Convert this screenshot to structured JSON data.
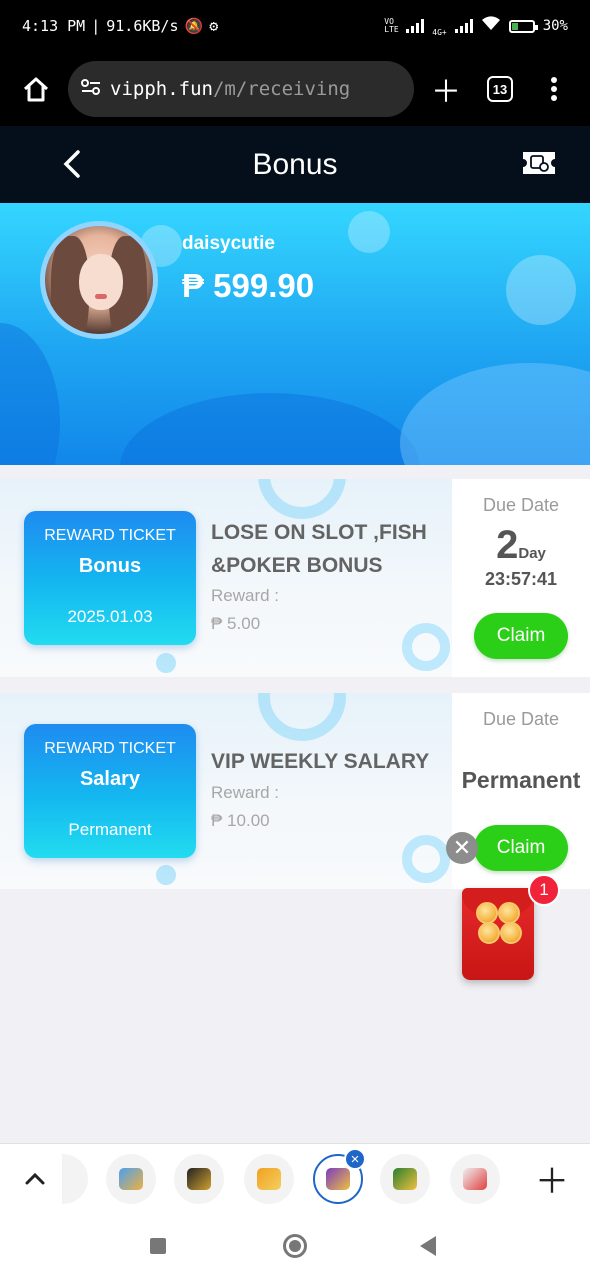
{
  "status_bar": {
    "time": "4:13 PM",
    "net_speed": "91.6KB/s",
    "battery": "30%",
    "network_label": "4G+",
    "volte_label": "VO LTE"
  },
  "browser": {
    "url_domain": "vipph.fun",
    "url_path": "/m/receiving",
    "tab_count": "13"
  },
  "header": {
    "title": "Bonus"
  },
  "profile": {
    "username": "daisycutie",
    "balance": "₱ 599.90"
  },
  "bonuses": [
    {
      "ticket_label": "REWARD TICKET",
      "ticket_name": "Bonus",
      "ticket_date": "2025.01.03",
      "title_line1": "LOSE ON SLOT ,FISH",
      "title_line2": "&POKER BONUS",
      "reward_label": "Reward :",
      "reward_value": "₱ 5.00",
      "due_label": "Due Date",
      "due_days": "2",
      "due_days_unit": "Day",
      "due_time": "23:57:41",
      "claim_label": "Claim"
    },
    {
      "ticket_label": "REWARD TICKET",
      "ticket_name": "Salary",
      "ticket_date": "Permanent",
      "title_line1": "VIP WEEKLY SALARY",
      "reward_label": "Reward :",
      "reward_value": "₱ 10.00",
      "due_label": "Due Date",
      "due_value": "Permanent",
      "claim_label": "Claim"
    }
  ],
  "floating_envelope": {
    "badge_count": "1"
  },
  "tab_strip": {
    "active_close": "×"
  },
  "colors": {
    "header_bg": "#050f1c",
    "hero_top": "#34d6ff",
    "hero_bottom": "#1187ea",
    "claim_green": "#2ccf17",
    "ticket_blue": "#1e8bf0"
  }
}
